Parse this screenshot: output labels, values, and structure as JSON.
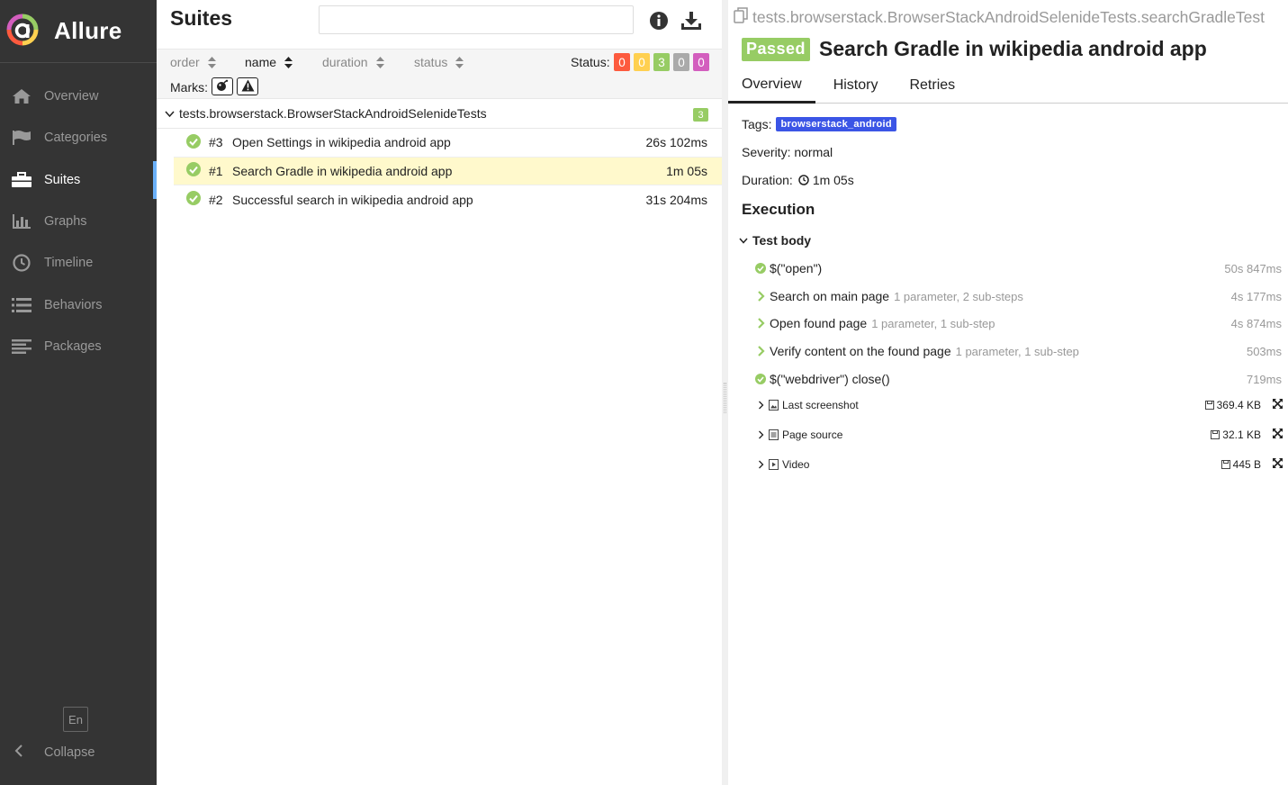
{
  "brand": {
    "name": "Allure"
  },
  "nav": {
    "overview": "Overview",
    "categories": "Categories",
    "suites": "Suites",
    "graphs": "Graphs",
    "timeline": "Timeline",
    "behaviors": "Behaviors",
    "packages": "Packages"
  },
  "lang": "En",
  "collapse": "Collapse",
  "suites_pane": {
    "title": "Suites",
    "search_value": "",
    "sort": {
      "order": "order",
      "name": "name",
      "duration": "duration",
      "status": "status"
    },
    "status_label": "Status:",
    "status_counts": {
      "failed": "0",
      "broken": "0",
      "passed": "3",
      "skipped": "0",
      "unknown": "0"
    },
    "marks_label": "Marks:",
    "group": {
      "name": "tests.browserstack.BrowserStackAndroidSelenideTests",
      "count": "3"
    },
    "tests": [
      {
        "num": "#3",
        "name": "Open Settings in wikipedia android app",
        "duration": "26s 102ms"
      },
      {
        "num": "#1",
        "name": "Search Gradle in wikipedia android app",
        "duration": "1m 05s"
      },
      {
        "num": "#2",
        "name": "Successful search in wikipedia android app",
        "duration": "31s 204ms"
      }
    ]
  },
  "detail": {
    "path": "tests.browserstack.BrowserStackAndroidSelenideTests.searchGradleTest",
    "status": "Passed",
    "title": "Search Gradle in wikipedia android app",
    "tabs": [
      "Overview",
      "History",
      "Retries"
    ],
    "tags_label": "Tags:",
    "tag": "browserstack_android",
    "severity": "Severity: normal",
    "duration_label": "Duration:",
    "duration": "1m 05s",
    "execution": "Execution",
    "test_body": "Test body",
    "steps": [
      {
        "name": "$(\"open\")",
        "meta": "",
        "duration": "50s 847ms"
      },
      {
        "name": "Search on main page",
        "meta": "1 parameter, 2 sub-steps",
        "duration": "4s 177ms"
      },
      {
        "name": "Open found page",
        "meta": "1 parameter, 1 sub-step",
        "duration": "4s 874ms"
      },
      {
        "name": "Verify content on the found page",
        "meta": "1 parameter, 1 sub-step",
        "duration": "503ms"
      },
      {
        "name": "$(\"webdriver\") close()",
        "meta": "",
        "duration": "719ms"
      }
    ],
    "attachments": [
      {
        "name": "Last screenshot",
        "size": "369.4 KB"
      },
      {
        "name": "Page source",
        "size": "32.1 KB"
      },
      {
        "name": "Video",
        "size": "445 B"
      }
    ]
  },
  "colors": {
    "sidebar": "#343434",
    "passed": "#97cc64",
    "failed": "#fd5a3e",
    "broken": "#ffd050",
    "skipped": "#aaaaaa",
    "unknown": "#d35ebe",
    "tag": "#3b55e6",
    "selected_row": "#fff9cc",
    "active_nav_marker": "#6bb1f9"
  }
}
